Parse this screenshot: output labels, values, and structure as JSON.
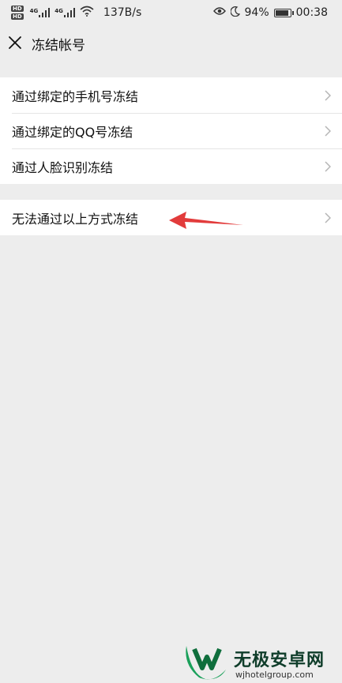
{
  "status_bar": {
    "hd_badge": "HD",
    "network_tag": "4G",
    "speed": "137B/s",
    "battery_percent": "94%",
    "battery_level": 0.94,
    "time": "00:38",
    "icons": [
      "signal-icon",
      "wifi-icon",
      "eye-icon",
      "moon-icon",
      "battery-icon"
    ]
  },
  "header": {
    "title": "冻结帐号",
    "close_icon": "close-icon"
  },
  "options": [
    {
      "label": "通过绑定的手机号冻结"
    },
    {
      "label": "通过绑定的QQ号冻结"
    },
    {
      "label": "通过人脸识别冻结"
    }
  ],
  "fallback_option": {
    "label": "无法通过以上方式冻结"
  },
  "annotation": {
    "arrow_color": "#e23b3b"
  },
  "watermark": {
    "title": "无极安卓网",
    "url": "wjhotelgroup.com",
    "brand_color": "#1aa05a"
  }
}
